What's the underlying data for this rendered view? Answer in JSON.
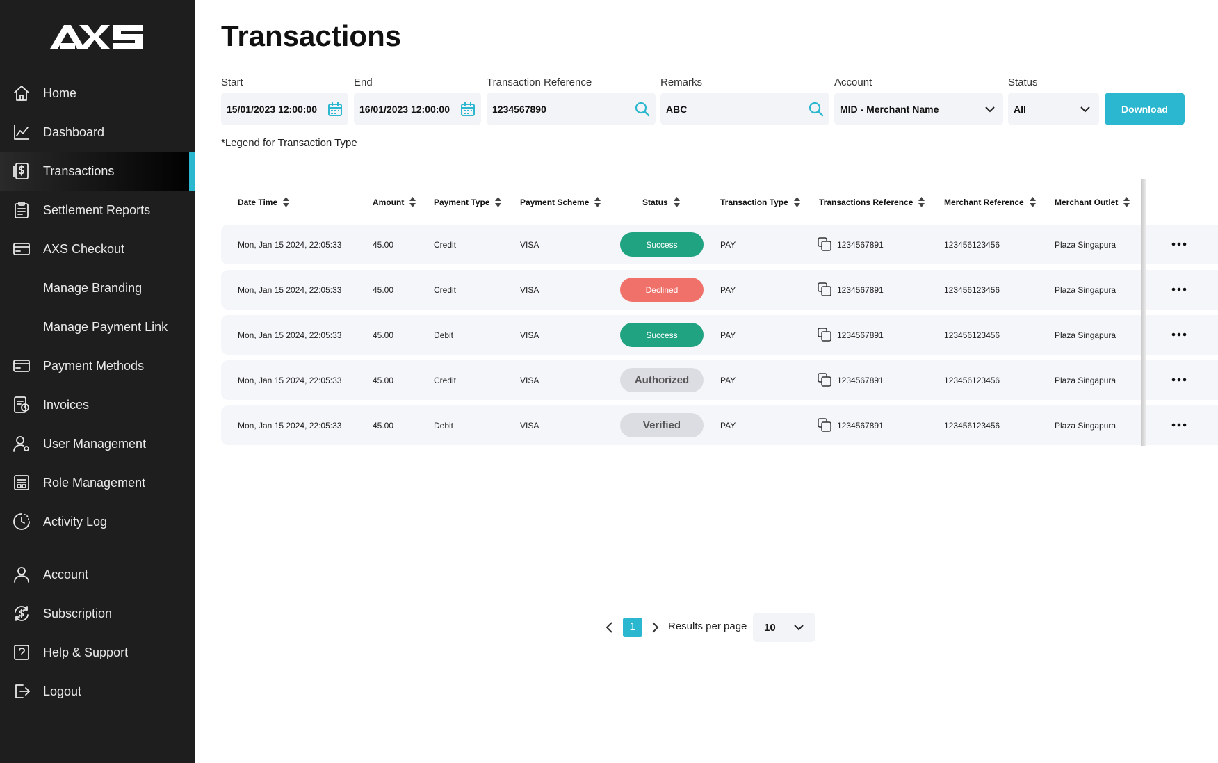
{
  "brand": {
    "logo_text": "AXS",
    "accent": "#2bb7cf"
  },
  "sidebar": {
    "items": [
      {
        "label": "Home",
        "icon": "home-icon"
      },
      {
        "label": "Dashboard",
        "icon": "chart-icon"
      },
      {
        "label": "Transactions",
        "icon": "dollar-receipt-icon",
        "active": true
      },
      {
        "label": "Settlement Reports",
        "icon": "clipboard-icon"
      },
      {
        "label": "AXS Checkout",
        "icon": "card-icon"
      },
      {
        "label": "Manage Branding",
        "icon": ""
      },
      {
        "label": "Manage Payment Link",
        "icon": ""
      },
      {
        "label": "Payment Methods",
        "icon": "credit-card-icon"
      },
      {
        "label": "Invoices",
        "icon": "invoice-icon"
      },
      {
        "label": "User Management",
        "icon": "user-gear-icon"
      },
      {
        "label": "Role Management",
        "icon": "roles-icon"
      },
      {
        "label": "Activity Log",
        "icon": "clock-icon"
      }
    ],
    "bottom_items": [
      {
        "label": "Account",
        "icon": "user-icon"
      },
      {
        "label": "Subscription",
        "icon": "subscription-icon"
      },
      {
        "label": "Help & Support",
        "icon": "help-icon"
      },
      {
        "label": "Logout",
        "icon": "logout-icon"
      }
    ]
  },
  "page": {
    "title": "Transactions"
  },
  "filters": {
    "start": {
      "label": "Start",
      "value": "15/01/2023  12:00:00"
    },
    "end": {
      "label": "End",
      "value": "16/01/2023  12:00:00"
    },
    "reference": {
      "label": "Transaction Reference",
      "value": "1234567890"
    },
    "remarks": {
      "label": "Remarks",
      "value": "ABC"
    },
    "account": {
      "label": "Account",
      "value": "MID - Merchant Name"
    },
    "status": {
      "label": "Status",
      "value": "All"
    },
    "download_label": "Download",
    "legend_note": "*Legend for Transaction Type"
  },
  "table": {
    "columns": [
      "Date Time",
      "Amount",
      "Payment Type",
      "Payment Scheme",
      "Status",
      "Transaction Type",
      "Transactions Reference",
      "Merchant Reference",
      "Merchant Outlet"
    ],
    "rows": [
      {
        "datetime": "Mon, Jan 15 2024, 22:05:33",
        "amount": "45.00",
        "payment_type": "Credit",
        "scheme": "VISA",
        "status": "Success",
        "status_kind": "success",
        "txn_type": "PAY",
        "txn_ref": "1234567891",
        "merchant_ref": "123456123456",
        "outlet": "Plaza Singapura"
      },
      {
        "datetime": "Mon, Jan 15 2024, 22:05:33",
        "amount": "45.00",
        "payment_type": "Credit",
        "scheme": "VISA",
        "status": "Declined",
        "status_kind": "declined",
        "txn_type": "PAY",
        "txn_ref": "1234567891",
        "merchant_ref": "123456123456",
        "outlet": "Plaza Singapura"
      },
      {
        "datetime": "Mon, Jan 15 2024, 22:05:33",
        "amount": "45.00",
        "payment_type": "Debit",
        "scheme": "VISA",
        "status": "Success",
        "status_kind": "success",
        "txn_type": "PAY",
        "txn_ref": "1234567891",
        "merchant_ref": "123456123456",
        "outlet": "Plaza Singapura"
      },
      {
        "datetime": "Mon, Jan 15 2024, 22:05:33",
        "amount": "45.00",
        "payment_type": "Credit",
        "scheme": "VISA",
        "status": "Authorized",
        "status_kind": "authorized",
        "txn_type": "PAY",
        "txn_ref": "1234567891",
        "merchant_ref": "123456123456",
        "outlet": "Plaza Singapura"
      },
      {
        "datetime": "Mon, Jan 15 2024, 22:05:33",
        "amount": "45.00",
        "payment_type": "Debit",
        "scheme": "VISA",
        "status": "Verified",
        "status_kind": "verified",
        "txn_type": "PAY",
        "txn_ref": "1234567891",
        "merchant_ref": "123456123456",
        "outlet": "Plaza Singapura"
      }
    ]
  },
  "pagination": {
    "current_page": "1",
    "results_label": "Results per page",
    "per_page": "10"
  },
  "colors": {
    "success": "#1fa381",
    "declined": "#f0706a",
    "neutral_badge": "#dcdde2",
    "sidebar_bg": "#1e1e1e"
  }
}
